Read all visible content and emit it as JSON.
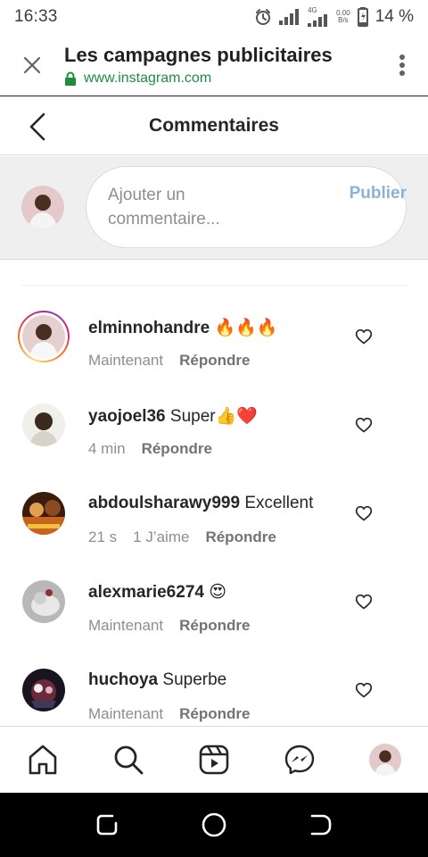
{
  "status_bar": {
    "time": "16:33",
    "network": "4G",
    "data_rate_top": "0.00",
    "data_rate_unit": "B/s",
    "battery": "14 %"
  },
  "browser": {
    "title": "Les campagnes publicitaires",
    "url": "www.instagram.com"
  },
  "header": {
    "title": "Commentaires"
  },
  "composer": {
    "placeholder": "Ajouter un commentaire...",
    "publish_label": "Publier"
  },
  "comments": [
    {
      "username": "elminnohandre",
      "text": "🔥🔥🔥",
      "time": "Maintenant",
      "likes": "",
      "reply_label": "Répondre",
      "story_ring": true,
      "avatar": "man-white-shirt"
    },
    {
      "username": "yaojoel36",
      "text": "Super👍❤️",
      "time": "4 min",
      "likes": "",
      "reply_label": "Répondre",
      "story_ring": false,
      "avatar": "man-light-background"
    },
    {
      "username": "abdoulsharawy999",
      "text": "Excellent",
      "time": "21 s",
      "likes": "1 J’aime",
      "reply_label": "Répondre",
      "story_ring": false,
      "avatar": "poster-orange"
    },
    {
      "username": "alexmarie6274",
      "text": "😍",
      "time": "Maintenant",
      "likes": "",
      "reply_label": "Répondre",
      "story_ring": false,
      "avatar": "animal-grey"
    },
    {
      "username": "huchoya",
      "text": "Superbe",
      "time": "Maintenant",
      "likes": "",
      "reply_label": "Répondre",
      "story_ring": false,
      "avatar": "anime-dark"
    }
  ],
  "bottom_nav": [
    "home-icon",
    "search-icon",
    "reels-icon",
    "messenger-icon",
    "profile-avatar"
  ],
  "colors": {
    "publish_disabled": "#8fb1d6",
    "secure_green": "#1e8e3e",
    "text": "#262626",
    "muted": "#8e8e8e"
  }
}
